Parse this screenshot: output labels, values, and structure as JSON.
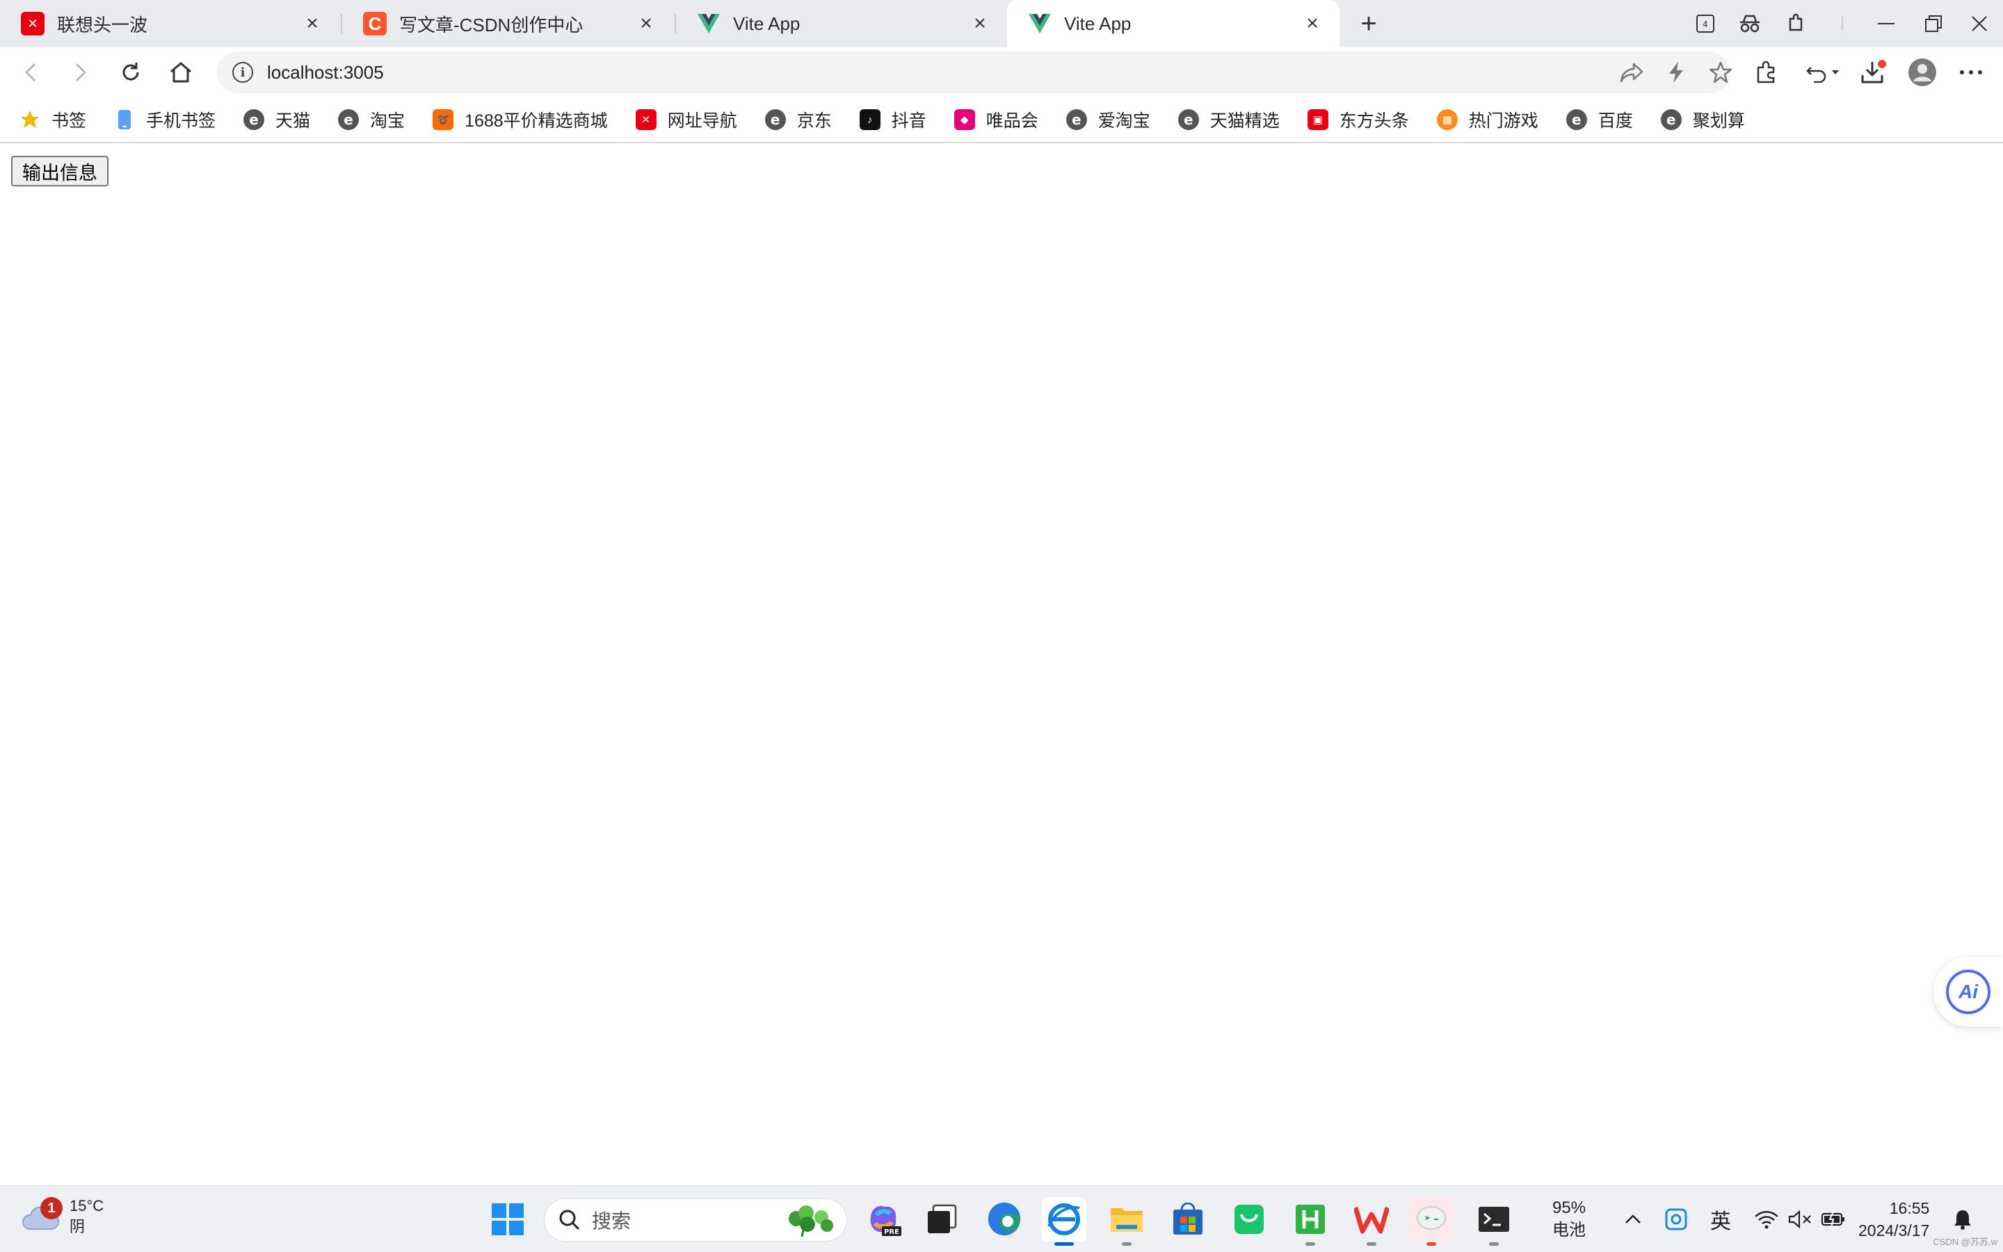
{
  "tabs": [
    {
      "title": "联想头一波",
      "favicon": "lenovo-icon",
      "color": "#e60012",
      "active": false
    },
    {
      "title": "写文章-CSDN创作中心",
      "favicon": "csdn-icon",
      "color": "#fc5531",
      "active": false
    },
    {
      "title": "Vite App",
      "favicon": "vue-icon",
      "color": "#41b883",
      "active": false
    },
    {
      "title": "Vite App",
      "favicon": "vue-icon",
      "color": "#41b883",
      "active": true
    }
  ],
  "address": {
    "url": "localhost:3005"
  },
  "bookmarks": [
    {
      "label": "书签",
      "icon": "star-icon"
    },
    {
      "label": "手机书签",
      "icon": "phone-icon"
    },
    {
      "label": "天猫",
      "icon": "e-browser-icon"
    },
    {
      "label": "淘宝",
      "icon": "e-browser-icon"
    },
    {
      "label": "1688平价精选商城",
      "icon": "1688-icon"
    },
    {
      "label": "网址导航",
      "icon": "lenovo-icon"
    },
    {
      "label": "京东",
      "icon": "e-browser-icon"
    },
    {
      "label": "抖音",
      "icon": "douyin-icon"
    },
    {
      "label": "唯品会",
      "icon": "vip-icon"
    },
    {
      "label": "爱淘宝",
      "icon": "e-browser-icon"
    },
    {
      "label": "天猫精选",
      "icon": "e-browser-icon"
    },
    {
      "label": "东方头条",
      "icon": "dongfang-icon"
    },
    {
      "label": "热门游戏",
      "icon": "game-icon"
    },
    {
      "label": "百度",
      "icon": "e-browser-icon"
    },
    {
      "label": "聚划算",
      "icon": "e-browser-icon"
    }
  ],
  "page": {
    "button_label": "输出信息"
  },
  "ai": {
    "label": "Ai"
  },
  "taskbar": {
    "weather": {
      "badge": "1",
      "temp": "15°C",
      "condition": "阴"
    },
    "search_label": "搜索",
    "copilot_badge": "PRE",
    "battery": {
      "percent": "95%",
      "label": "电池"
    },
    "ime": "英",
    "time": "16:55",
    "date": "2024/3/17"
  },
  "watermark": "CSDN @苏苏.w",
  "colors": {
    "accent": "#0067c0",
    "tabbar": "#e9ebee",
    "omnibox": "#f1f3f4"
  }
}
